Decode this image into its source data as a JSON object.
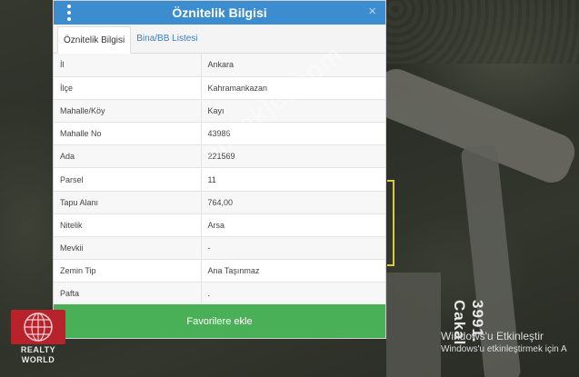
{
  "panel": {
    "title": "Öznitelik Bilgisi",
    "close_label": "×",
    "tabs": [
      {
        "label": "Öznitelik Bilgisi"
      },
      {
        "label": "Bina/BB Listesi"
      }
    ],
    "rows": [
      {
        "key": "İl",
        "value": "Ankara"
      },
      {
        "key": "İlçe",
        "value": "Kahramankazan"
      },
      {
        "key": "Mahalle/Köy",
        "value": "Kayı"
      },
      {
        "key": "Mahalle No",
        "value": "43986"
      },
      {
        "key": "Ada",
        "value": "221569"
      },
      {
        "key": "Parsel",
        "value": "11"
      },
      {
        "key": "Tapu Alanı",
        "value": "764,00"
      },
      {
        "key": "Nitelik",
        "value": "Arsa"
      },
      {
        "key": "Mevkii",
        "value": "-"
      },
      {
        "key": "Zemin Tip",
        "value": "Ana Taşınmaz"
      },
      {
        "key": "Pafta",
        "value": "."
      }
    ],
    "favorite_button": "Favorilere ekle"
  },
  "map": {
    "road_label": "3991. Cakal"
  },
  "watermark": "emlakjet.com",
  "logo": {
    "line1": "REALTY",
    "line2": "WORLD"
  },
  "activation": {
    "title": "Windows'u Etkinleştir",
    "subtitle": "Windows'u etkinleştirmek için A"
  },
  "colors": {
    "header": "#3c8dcf",
    "button": "#49b057",
    "logo": "#b8232b"
  }
}
